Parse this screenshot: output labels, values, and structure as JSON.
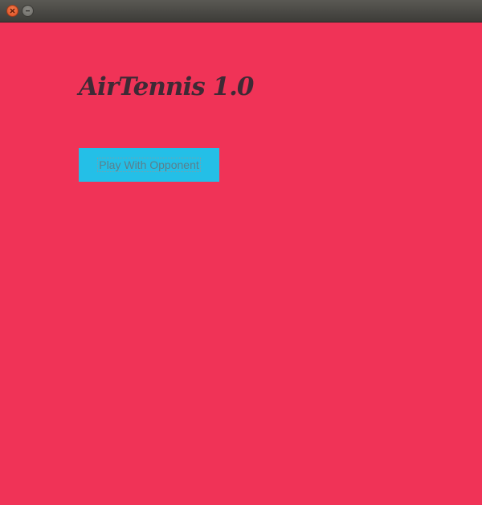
{
  "window": {
    "close_icon": "close-icon",
    "minimize_icon": "minimize-icon"
  },
  "app": {
    "title": "AirTennis 1.0",
    "play_button_label": "Play With Opponent"
  },
  "colors": {
    "background": "#f03357",
    "button": "#24bfe7",
    "title_text": "#3e2a35"
  }
}
